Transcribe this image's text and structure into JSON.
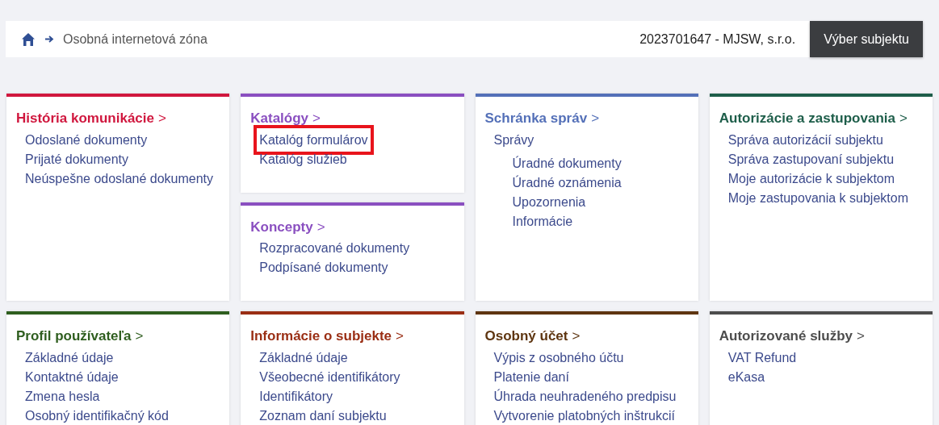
{
  "header": {
    "breadcrumb": "Osobná internetová zóna",
    "subject": "2023701647 - MJSW, s.r.o.",
    "button": "Výber subjektu"
  },
  "rows": [
    {
      "columns": [
        [
          {
            "title": "História komunikácie",
            "arrow": ">",
            "color": "#d0173e",
            "items": [
              {
                "label": "Odoslané dokumenty",
                "highlighted": false
              },
              {
                "label": "Prijaté dokumenty",
                "highlighted": false
              },
              {
                "label": "Neúspešne odoslané dokumenty",
                "highlighted": false
              }
            ]
          }
        ],
        [
          {
            "title": "Katalógy",
            "arrow": ">",
            "color": "#8a4fc0",
            "items": [
              {
                "label": "Katalóg formulárov",
                "highlighted": true
              },
              {
                "label": "Katalóg služieb",
                "highlighted": false
              }
            ]
          },
          {
            "title": "Koncepty",
            "arrow": ">",
            "color": "#8a4fc0",
            "items": [
              {
                "label": "Rozpracované dokumenty",
                "highlighted": false
              },
              {
                "label": "Podpísané dokumenty",
                "highlighted": false
              }
            ]
          }
        ],
        [
          {
            "title": "Schránka správ",
            "arrow": ">",
            "color": "#5470b8",
            "items": [
              {
                "label": "Správy",
                "highlighted": false,
                "children": [
                  {
                    "label": "Úradné dokumenty",
                    "highlighted": false
                  },
                  {
                    "label": "Úradné oznámenia",
                    "highlighted": false
                  },
                  {
                    "label": "Upozornenia",
                    "highlighted": false
                  },
                  {
                    "label": "Informácie",
                    "highlighted": false
                  }
                ]
              }
            ]
          }
        ],
        [
          {
            "title": "Autorizácie a zastupovania",
            "arrow": ">",
            "color": "#1e5e4a",
            "items": [
              {
                "label": "Správa autorizácií subjektu",
                "highlighted": false
              },
              {
                "label": "Správa zastupovaní subjektu",
                "highlighted": false
              },
              {
                "label": "Moje autorizácie k subjektom",
                "highlighted": false
              },
              {
                "label": "Moje zastupovania k subjektom",
                "highlighted": false
              }
            ]
          }
        ]
      ]
    },
    {
      "columns": [
        [
          {
            "title": "Profil používateľa",
            "arrow": ">",
            "color": "#2f5e1f",
            "items": [
              {
                "label": "Základné údaje",
                "highlighted": false
              },
              {
                "label": "Kontaktné údaje",
                "highlighted": false
              },
              {
                "label": "Zmena hesla",
                "highlighted": false
              },
              {
                "label": "Osobný identifikačný kód",
                "highlighted": false
              }
            ]
          }
        ],
        [
          {
            "title": "Informácie o subjekte",
            "arrow": ">",
            "color": "#9a2e14",
            "items": [
              {
                "label": "Základné údaje",
                "highlighted": false
              },
              {
                "label": "Všeobecné identifikátory",
                "highlighted": false
              },
              {
                "label": "Identifikátory",
                "highlighted": false
              },
              {
                "label": "Zoznam daní subjektu",
                "highlighted": false
              }
            ]
          }
        ],
        [
          {
            "title": "Osobný účet",
            "arrow": ">",
            "color": "#5e3510",
            "items": [
              {
                "label": "Výpis z osobného účtu",
                "highlighted": false
              },
              {
                "label": "Platenie daní",
                "highlighted": false
              },
              {
                "label": "Úhrada neuhradeného predpisu",
                "highlighted": false
              },
              {
                "label": "Vytvorenie platobných inštrukcií",
                "highlighted": false
              }
            ]
          }
        ],
        [
          {
            "title": "Autorizované služby",
            "arrow": ">",
            "color": "#4d4d4d",
            "items": [
              {
                "label": "VAT Refund",
                "highlighted": false
              },
              {
                "label": "eKasa",
                "highlighted": false
              }
            ]
          }
        ]
      ]
    }
  ]
}
